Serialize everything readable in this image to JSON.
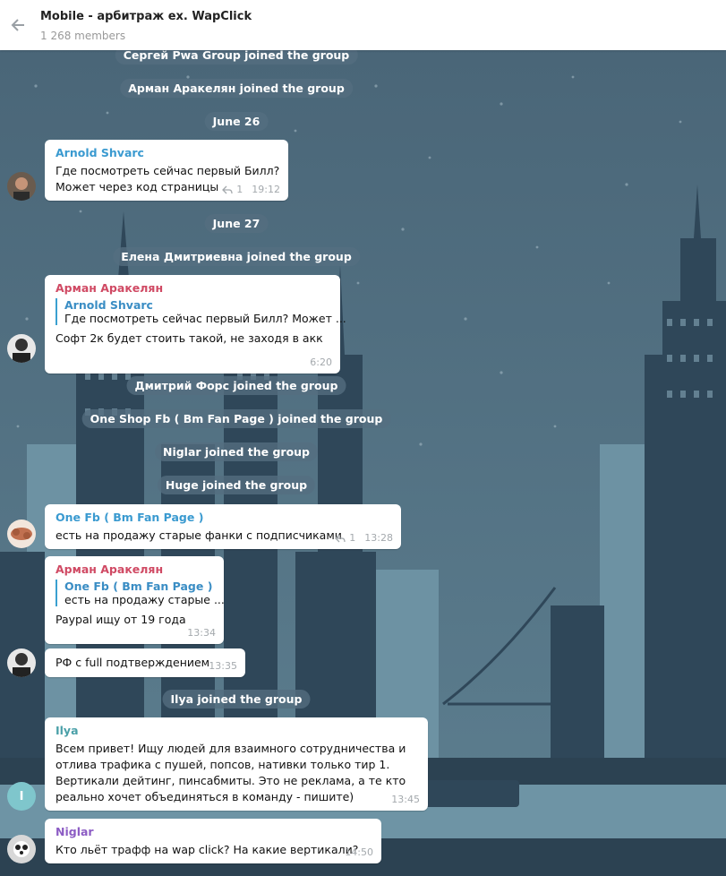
{
  "header": {
    "title": "Mobile - арбитраж ex. WapClick",
    "members": "1 268 members"
  },
  "colors": {
    "sender_blue": "#3a9ad0",
    "sender_red": "#d04a64",
    "sender_green": "#4aa0a8",
    "sender_purple": "#8c5cc4",
    "background": "#3e5b70"
  },
  "services": {
    "s1": "Сергей Pwa Group joined the group",
    "s2": "Арман Аракелян joined the group",
    "d1": "June 26",
    "d2": "June 27",
    "s3": "Елена Дмитриевна joined the group",
    "s4": "Дмитрий Форс joined the group",
    "s5": "One Shop Fb ( Bm Fan Page ) joined the group",
    "s6": "Niglar joined the group",
    "s7": "Huge joined the group",
    "s8": "Ilya joined the group"
  },
  "messages": {
    "m1": {
      "author": "Arnold Shvarc",
      "lines": [
        "Где посмотреть сейчас первый Билл?",
        "Может через код страницы"
      ],
      "replies": "1",
      "time": "19:12"
    },
    "m2": {
      "author": "Арман Аракелян",
      "reply_author": "Arnold Shvarc",
      "reply_text": "Где посмотреть сейчас первый Билл? Может ...",
      "text": "Софт 2к будет стоить такой, не заходя в акк",
      "time": "6:20"
    },
    "m3": {
      "author": "One Fb ( Bm Fan Page )",
      "text": "есть на продажу старые фанки с подписчиками",
      "replies": "1",
      "time": "13:28"
    },
    "m4": {
      "author": "Арман Аракелян",
      "reply_author": "One Fb ( Bm Fan Page )",
      "reply_text": "есть на продажу старые ...",
      "text": "Paypal ищу от 19 года",
      "time": "13:34"
    },
    "m5": {
      "text": "РФ с full подтверждением",
      "time": "13:35"
    },
    "m6": {
      "author": "Ilya",
      "lines": [
        "Всем привет! Ищу людей для взаимного сотрудничества и",
        "отлива трафика с пушей, попсов, нативки только тир 1.",
        "Вертикали дейтинг, пинсабмиты. Это не реклама, а те кто",
        "реально хочет объединяться в команду - пишите)"
      ],
      "time": "13:45",
      "avatar_letter": "I"
    },
    "m7": {
      "author": "Niglar",
      "text": "Кто льёт трафф на wap  click? На какие вертикали?",
      "time": "14:50"
    }
  }
}
